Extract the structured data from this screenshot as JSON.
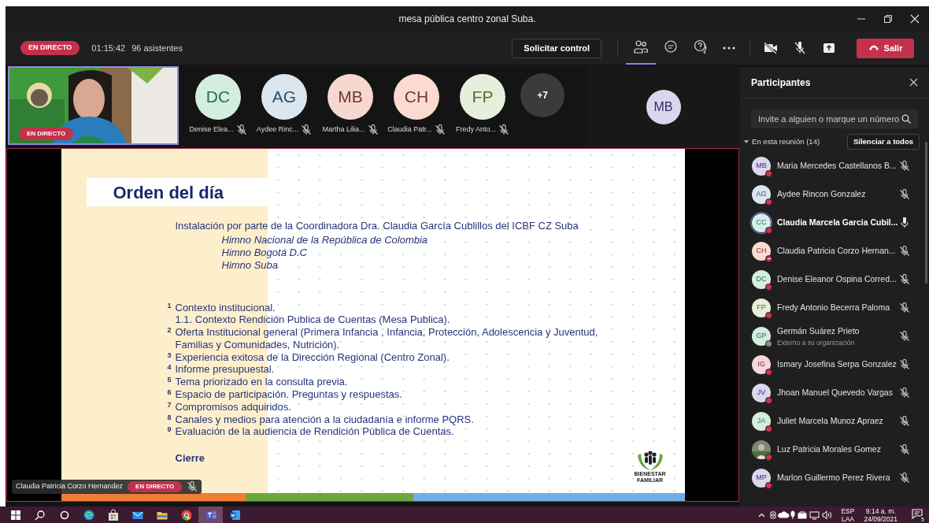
{
  "window": {
    "title": "mesa pública centro zonal Suba."
  },
  "meeting_bar": {
    "live_badge": "EN DIRECTO",
    "elapsed": "01:15:42",
    "attendees": "96 asistentes",
    "request_control": "Solicitar control",
    "tabs": [
      {
        "kind": "people",
        "selected": true
      },
      {
        "kind": "chat",
        "selected": false
      },
      {
        "kind": "question",
        "selected": false
      }
    ],
    "camera_on": false,
    "mic_on": false,
    "leave": "Salir"
  },
  "video_tile": {
    "kind": "picture",
    "badge": "EN DIRECTO",
    "selected": true
  },
  "gallery": [
    {
      "initials": "DC",
      "name": "Denise Elea...",
      "color": "#d3eddf",
      "muted": true
    },
    {
      "initials": "AG",
      "name": "Aydee Rinc...",
      "color": "#dbe6ee",
      "muted": true
    },
    {
      "initials": "MB",
      "name": "Martha Lilia...",
      "color": "#f7d8d0",
      "muted": true
    },
    {
      "initials": "CH",
      "name": "Claudia Patr...",
      "color": "#fbdad0",
      "muted": true
    },
    {
      "initials": "FP",
      "name": "Fredy Anto...",
      "color": "#e6efdb",
      "muted": true
    }
  ],
  "gallery_overflow": "+7",
  "stage_avatar": {
    "initials": "MB",
    "color": "#d9d6ee"
  },
  "slide": {
    "title": "Orden del día",
    "intro": "Instalación por parte de la Coordinadora Dra. Claudia García Cublillos del ICBF CZ Suba",
    "anthems": [
      "Himno Nacional de la República de Colombia",
      "Himno Bogotá D.C",
      "Himno Suba"
    ],
    "agenda": [
      {
        "number": "1",
        "text": "Contexto institucional."
      },
      {
        "text": "1.1. Contexto Rendición Publica de Cuentas (Mesa Publica)."
      },
      {
        "number": "2",
        "text": "Oferta Institucional general (Primera Infancia , Infancia, Protección, Adolescencia y Juventud, Familias y Comunidades, Nutrición)."
      },
      {
        "number": "3",
        "text": "Experiencia exitosa de la Dirección Regional (Centro Zonal)."
      },
      {
        "number": "4",
        "text": "Informe presupuestal."
      },
      {
        "number": "5",
        "text": "Tema priorizado en la consulta previa."
      },
      {
        "number": "6",
        "text": "Espacio de participación. Preguntas y respuestas."
      },
      {
        "number": "7",
        "text": "Compromisos adquiridos."
      },
      {
        "number": "8",
        "text": "Canales y medios para atención a la ciudadanía e informe PQRS."
      },
      {
        "number": "9",
        "text": "Evaluación de la audiencia de Rendición Pública de Cuentas."
      }
    ],
    "closing": "Cierre",
    "logo_lines": [
      "BIENESTAR",
      "FAMILIAR"
    ]
  },
  "presenter": {
    "name": "Claudia Patricia Corzo Hernandez",
    "badge": "EN DIRECTO",
    "muted": true
  },
  "participants_panel": {
    "title": "Participantes",
    "search": {
      "placeholder": "Invite a alguien o marque un número"
    },
    "section": {
      "label": "En esta reunión (14)",
      "expanded": true,
      "mute_all": "Silenciar a todos"
    },
    "participants": [
      {
        "kind": "initials",
        "initials": "MB",
        "name": "Maria Mercedes Castellanos B...",
        "color": "#dcd6ee",
        "dnd": false,
        "external": false,
        "muted": true,
        "speaking": false
      },
      {
        "kind": "initials",
        "initials": "AG",
        "name": "Aydee Rincon Gonzalez",
        "color": "#dbe6ee",
        "dnd": false,
        "external": false,
        "muted": true,
        "speaking": false
      },
      {
        "kind": "initials",
        "initials": "CC",
        "name": "Claudia Marcela Garcia Cubil...",
        "color": "#d5eeec",
        "dnd": false,
        "external": false,
        "muted": false,
        "speaking": true
      },
      {
        "kind": "initials",
        "initials": "CH",
        "name": "Claudia Patricia Corzo Hernan...",
        "color": "#fbdad0",
        "dnd": true,
        "external": false,
        "muted": true,
        "speaking": false
      },
      {
        "kind": "initials",
        "initials": "DC",
        "name": "Denise Eleanor Ospina Corred...",
        "color": "#d3eddf",
        "dnd": false,
        "external": false,
        "muted": true,
        "speaking": false
      },
      {
        "kind": "initials",
        "initials": "FP",
        "name": "Fredy Antonio Becerra Paloma",
        "color": "#e6efdb",
        "dnd": false,
        "external": false,
        "muted": true,
        "speaking": false
      },
      {
        "kind": "initials",
        "initials": "GP",
        "name": "Germán Suárez Prieto",
        "subtitle": "Externo a su organización",
        "color": "#d3eddf",
        "dnd": false,
        "external": true,
        "muted": true,
        "speaking": false
      },
      {
        "kind": "initials",
        "initials": "IG",
        "name": "Ismary Josefina Serpa Gonzalez",
        "color": "#f8d6de",
        "dnd": false,
        "external": false,
        "muted": true,
        "speaking": false
      },
      {
        "kind": "initials",
        "initials": "JV",
        "name": "Jhoan Manuel Quevedo Vargas",
        "color": "#dcd6ee",
        "dnd": false,
        "external": false,
        "muted": true,
        "speaking": false
      },
      {
        "kind": "initials",
        "initials": "JA",
        "name": "Juliet Marcela Munoz Apraez",
        "color": "#d3eddf",
        "dnd": false,
        "external": false,
        "muted": true,
        "speaking": false
      },
      {
        "name": "Luz Patricia Morales Gomez",
        "dnd": false,
        "external": false,
        "muted": true,
        "speaking": false
      },
      {
        "kind": "initials",
        "initials": "MP",
        "name": "Marlon Guillermo Perez Rivera",
        "color": "#dcd6ee",
        "dnd": false,
        "external": false,
        "muted": true,
        "speaking": false
      }
    ]
  },
  "taskbar": {
    "apps": [
      {
        "kind": "windows",
        "selected": false
      },
      {
        "kind": "search",
        "selected": false
      },
      {
        "kind": "cortana",
        "selected": false
      },
      {
        "kind": "edge",
        "selected": false
      },
      {
        "kind": "store",
        "selected": false
      },
      {
        "kind": "mail",
        "selected": false
      },
      {
        "kind": "folder",
        "selected": false
      },
      {
        "kind": "chrome",
        "selected": false
      },
      {
        "kind": "teams",
        "selected": true
      },
      {
        "kind": "word",
        "selected": false
      }
    ],
    "language": "ESP",
    "layout": "LAA",
    "time": "9:14 a. m.",
    "date": "24/09/2021",
    "notifications": "5"
  }
}
